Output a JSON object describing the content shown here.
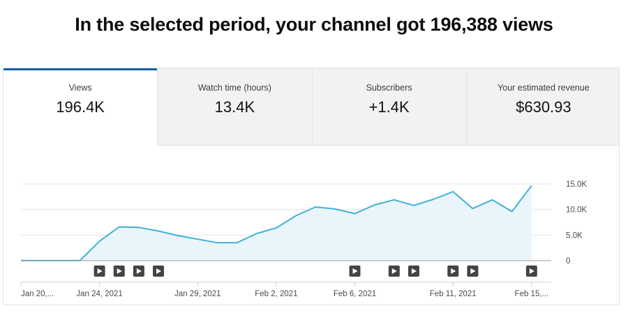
{
  "headline": "In the selected period, your channel got 196,388 views",
  "tabs": [
    {
      "label": "Views",
      "value": "196.4K",
      "active": true
    },
    {
      "label": "Watch time (hours)",
      "value": "13.4K",
      "active": false
    },
    {
      "label": "Subscribers",
      "value": "+1.4K",
      "active": false
    },
    {
      "label": "Your estimated revenue",
      "value": "$630.93",
      "active": false
    }
  ],
  "colors": {
    "accent_tab": "#1a5ea8",
    "line": "#41b1d3",
    "area": "#e9f5fb",
    "grid": "#e6e6e6",
    "video_marker": "#444444"
  },
  "chart_data": {
    "type": "area",
    "title": "",
    "xlabel": "",
    "ylabel": "",
    "x_start": "Jan 20, 2021",
    "x": [
      "Jan 20",
      "Jan 21",
      "Jan 22",
      "Jan 23",
      "Jan 24",
      "Jan 25",
      "Jan 26",
      "Jan 27",
      "Jan 28",
      "Jan 29",
      "Jan 30",
      "Jan 31",
      "Feb 1",
      "Feb 2",
      "Feb 3",
      "Feb 4",
      "Feb 5",
      "Feb 6",
      "Feb 7",
      "Feb 8",
      "Feb 9",
      "Feb 10",
      "Feb 11",
      "Feb 12",
      "Feb 13",
      "Feb 14",
      "Feb 15",
      "Feb 16"
    ],
    "series": [
      {
        "values": [
          20,
          20,
          20,
          20,
          3800,
          6600,
          6500,
          5800,
          4900,
          4200,
          3500,
          3500,
          5300,
          6400,
          8800,
          10500,
          10100,
          9200,
          10900,
          11900,
          10800,
          12000,
          13500,
          10200,
          11900,
          9600,
          14700
        ]
      }
    ],
    "ylim": [
      0,
      15000
    ],
    "y_ticks": [
      {
        "value": 0,
        "label": "0"
      },
      {
        "value": 5000,
        "label": "5.0K"
      },
      {
        "value": 10000,
        "label": "10.0K"
      },
      {
        "value": 15000,
        "label": "15.0K"
      }
    ],
    "x_ticks": [
      {
        "index": 0,
        "label": "Jan 20,..."
      },
      {
        "index": 4,
        "label": "Jan 24, 2021"
      },
      {
        "index": 9,
        "label": "Jan 29, 2021"
      },
      {
        "index": 13,
        "label": "Feb 2, 2021"
      },
      {
        "index": 17,
        "label": "Feb 6, 2021"
      },
      {
        "index": 22,
        "label": "Feb 11, 2021"
      },
      {
        "index": 26,
        "label": "Feb 15,..."
      }
    ],
    "video_markers": [
      4,
      5,
      6,
      7,
      17,
      19,
      20,
      22,
      23,
      26
    ],
    "grid": true
  }
}
